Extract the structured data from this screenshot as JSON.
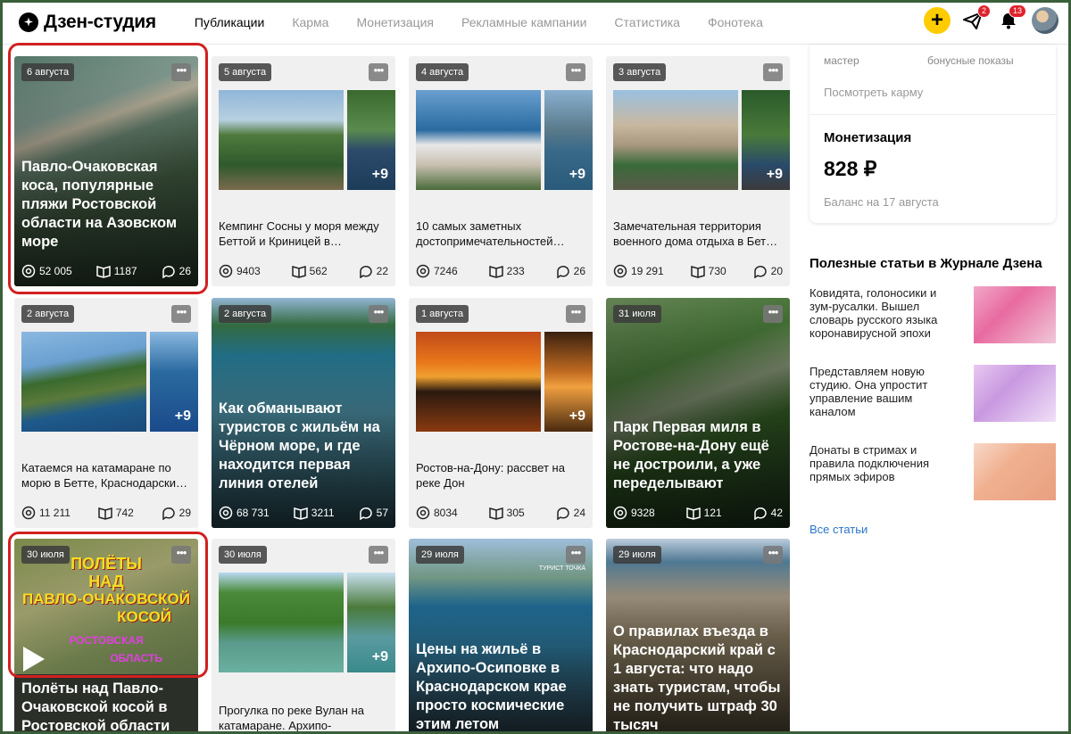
{
  "header": {
    "logo_text": "Дзен-студия",
    "nav": [
      "Публикации",
      "Карма",
      "Монетизация",
      "Рекламные кампании",
      "Статистика",
      "Фонотека"
    ],
    "active_nav": "Публикации",
    "add_label": "+",
    "messages_badge": "2",
    "notifications_badge": "13"
  },
  "cards": [
    {
      "date": "6 августа",
      "title": "Павло-Очаковская коса, популярные пляжи Ростовской области на Азовском море",
      "views": "52 005",
      "reads": "1187",
      "comments": "26"
    },
    {
      "date": "5 августа",
      "title": "Кемпинг Сосны у моря между Беттой и Криницей в…",
      "more_photos": "+9",
      "views": "9403",
      "reads": "562",
      "comments": "22"
    },
    {
      "date": "4 августа",
      "title": "10 самых заметных достопримечательностей…",
      "more_photos": "+9",
      "views": "7246",
      "reads": "233",
      "comments": "26"
    },
    {
      "date": "3 августа",
      "title": "Замечательная территория военного дома отдыха в Бет…",
      "more_photos": "+9",
      "views": "19 291",
      "reads": "730",
      "comments": "20"
    },
    {
      "date": "2 августа",
      "title": "Катаемся на катамаране по морю в Бетте, Краснодарски…",
      "more_photos": "+9",
      "views": "11 211",
      "reads": "742",
      "comments": "29"
    },
    {
      "date": "2 августа",
      "title": "Как обманывают туристов с жильём на Чёрном море, и где находится первая линия отелей",
      "views": "68 731",
      "reads": "3211",
      "comments": "57"
    },
    {
      "date": "1 августа",
      "title": "Ростов-на-Дону: рассвет на реке Дон",
      "more_photos": "+9",
      "views": "8034",
      "reads": "305",
      "comments": "24"
    },
    {
      "date": "31 июля",
      "title": "Парк Первая миля в Ростове-на-Дону ещё не достроили, а уже переделывают",
      "views": "9328",
      "reads": "121",
      "comments": "42"
    },
    {
      "date": "30 июля",
      "title": "Полёты над Павло-Очаковской косой в Ростовской области",
      "cover_text": [
        "ПОЛЁТЫ",
        "НАД",
        "ПАВЛО-ОЧАКОВСКОЙ",
        "КОСОЙ",
        "РОСТОВСКАЯ",
        "ОБЛАСТЬ"
      ]
    },
    {
      "date": "30 июля",
      "title": "Прогулка по реке Вулан на катамаране. Архипо-",
      "more_photos": "+9"
    },
    {
      "date": "29 июля",
      "title": "Цены на жильё в Архипо-Осиповке в Краснодарском крае просто космические этим летом",
      "watermark": "ТУРИСТ ТОЧКА"
    },
    {
      "date": "29 июля",
      "title": "О правилах въезда в Краснодарский край с 1 августа: что надо знать туристам, чтобы не получить штраф 30 тысяч"
    }
  ],
  "more_label": "•••",
  "karma": {
    "label_left": "мастер",
    "label_right": "бонусные показы",
    "link": "Посмотреть карму"
  },
  "monetization": {
    "title": "Монетизация",
    "value": "828 ₽",
    "subtitle": "Баланс на 17 августа"
  },
  "journal": {
    "title": "Полезные статьи в Журнале Дзена",
    "items": [
      {
        "text": "Ковидята, голоносики и зум-русалки. Вышел словарь русского языка коронавирусной эпохи"
      },
      {
        "text": "Представляем новую студию. Она упростит управление вашим каналом"
      },
      {
        "text": "Донаты в стримах и правила подключения прямых эфиров"
      }
    ],
    "all_link": "Все статьи"
  },
  "colors": {
    "accent": "#ffcc00",
    "highlight": "#d22020",
    "link": "#2b75c9",
    "badge": "#e0222c"
  }
}
